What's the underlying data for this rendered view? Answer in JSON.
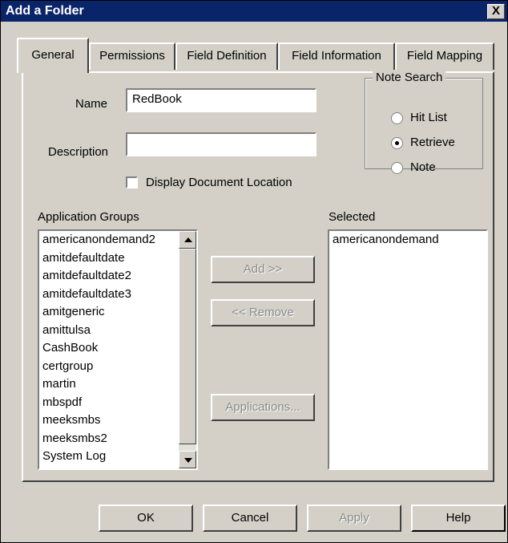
{
  "window": {
    "title": "Add a Folder",
    "close_label": "X"
  },
  "tabs": [
    {
      "label": "General"
    },
    {
      "label": "Permissions"
    },
    {
      "label": "Field Definition"
    },
    {
      "label": "Field Information"
    },
    {
      "label": "Field Mapping"
    }
  ],
  "form": {
    "name_label": "Name",
    "name_value": "RedBook",
    "description_label": "Description",
    "description_value": "",
    "display_location_label": "Display Document Location",
    "display_location_checked": false
  },
  "note_search": {
    "title": "Note Search",
    "options": [
      {
        "label": "Hit List",
        "selected": false
      },
      {
        "label": "Retrieve",
        "selected": true
      },
      {
        "label": "Note",
        "selected": false
      }
    ]
  },
  "application_groups": {
    "label": "Application Groups",
    "items": [
      "americanondemand2",
      "amitdefaultdate",
      "amitdefaultdate2",
      "amitdefaultdate3",
      "amitgeneric",
      "amittulsa",
      "CashBook",
      "certgroup",
      "martin",
      "mbspdf",
      "meeksmbs",
      "meeksmbs2",
      "System Log"
    ]
  },
  "selected": {
    "label": "Selected",
    "items": [
      "americanondemand"
    ]
  },
  "middle_buttons": {
    "add": "Add >>",
    "remove": "<< Remove",
    "applications": "Applications..."
  },
  "footer_buttons": {
    "ok": "OK",
    "cancel": "Cancel",
    "apply": "Apply",
    "help": "Help"
  }
}
